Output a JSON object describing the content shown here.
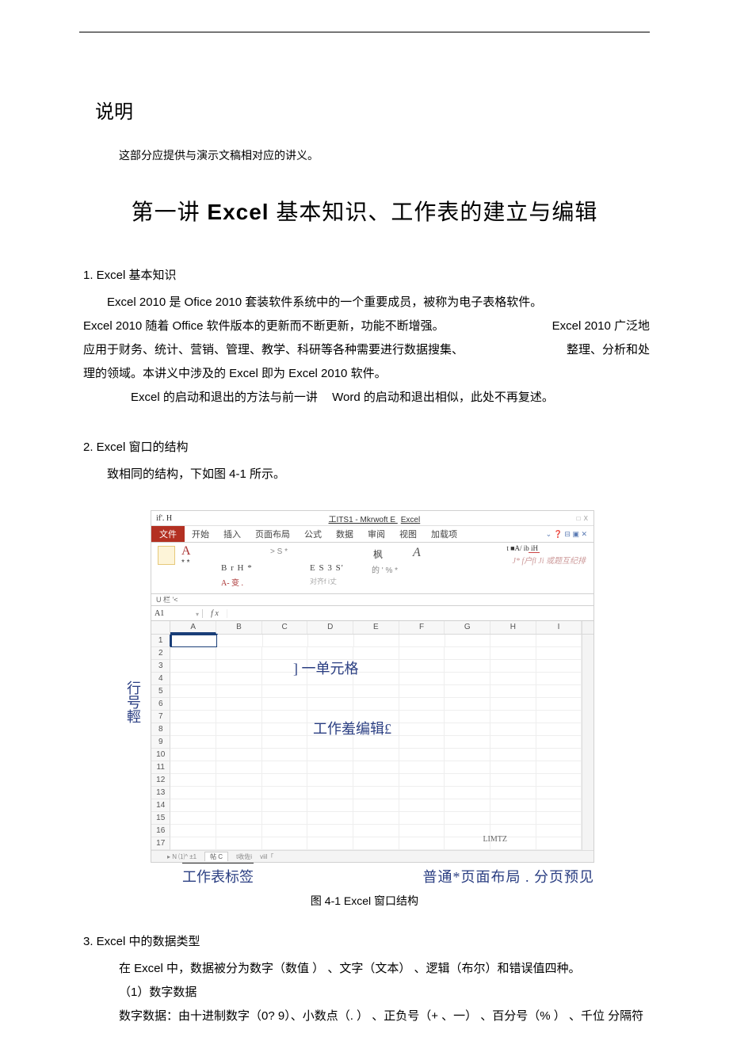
{
  "header": {
    "shuoming": "说明",
    "intro": "这部分应提供与演示文稿相对应的讲义。",
    "title_pre": "第一讲 ",
    "title_bold": "Excel",
    "title_post": " 基本知识、工作表的建立与编辑"
  },
  "section1": {
    "head": "1.  Excel 基本知识",
    "p1": "Excel 2010 是 Ofice 2010 套装软件系统中的一个重要成员，被称为电子表格软件。",
    "p2a": "Excel 2010 随着 Office 软件版本的更新而不断更新，功能不断增强。",
    "p2b": "Excel 2010 广泛地",
    "p3a": "应用于财务、统计、营销、管理、教学、科研等各种需要进行数据搜集、",
    "p3b": "整理、分析和处",
    "p4": "理的领域。本讲义中涉及的  Excel 即为 Excel 2010 软件。",
    "p5a": "Excel 的启动和退出的方法与前一讲",
    "p5b": "Word 的启动和退出相似，此处不再复述。"
  },
  "section2": {
    "head": "2.  Excel 窗口的结构",
    "p1": "致相同的结构，下如图  4-1 所示。"
  },
  "excel": {
    "titlebar_left": "if'. H",
    "titlebar_center": "工ITS1 - Mkrwoft E",
    "titlebar_center_suffix": "Excel",
    "titlebar_right": "□ X",
    "tabs": {
      "file": "文件",
      "start": "开始",
      "insert": "插入",
      "layout": "页面布局",
      "formula": "公式",
      "data": "数据",
      "review": "审阅",
      "view": "视图",
      "addin": "加载项"
    },
    "tab_icons": "⌄ ❓ ⊟ ▣ ✕",
    "ribbon": {
      "A_red": "A",
      "star": "* *",
      "brh": "B r H *",
      "aBian": "A- 变 .",
      "sb": "> S *",
      "es3s": "E S 3 S'",
      "duiqi": "对齐f i丈",
      "feng": "枫",
      "asterisk": "*",
      "de": "的 ' %  *",
      "A_italic": "A",
      "right_top": "t ■A/ ib iH",
      "right_red": "J* f户fl Ji 或题互纪排"
    },
    "u_row": "U 栏  '<",
    "namebox": "A1",
    "fx": "f x",
    "cols": [
      "A",
      "B",
      "C",
      "D",
      "E",
      "F",
      "G",
      "H",
      "I"
    ],
    "rows": [
      "1",
      "2",
      "3",
      "4",
      "5",
      "6",
      "7",
      "8",
      "9",
      "10",
      "11",
      "12",
      "13",
      "14",
      "15",
      "16",
      "17"
    ],
    "status": {
      "nav": "▸ N ⑴^ ±1",
      "tab1": "帖 C",
      "tab2": "t收佐i",
      "tab3": "viil「"
    }
  },
  "callouts": {
    "row_label": "行号輕",
    "cell_label": "] 一单元格",
    "edit_label": "工作羞编辑£",
    "limtz": "LIMTZ",
    "sheet_tab": "工作表标签",
    "views": "普通*页面布局 . 分页预见"
  },
  "figcap": "图 4-1 Excel 窗口结构",
  "section3": {
    "head": "3.  Excel 中的数据类型",
    "p1": "在 Excel 中，数据被分为数字（数值 ） 、文字（文本） 、逻辑（布尔）和错误值四种。",
    "p2": "（1）数字数据",
    "p3": "数字数据：由十进制数字（0? 9）、小数点（. ） 、正负号（+ 、一） 、百分号（% ） 、千位  分隔符"
  }
}
